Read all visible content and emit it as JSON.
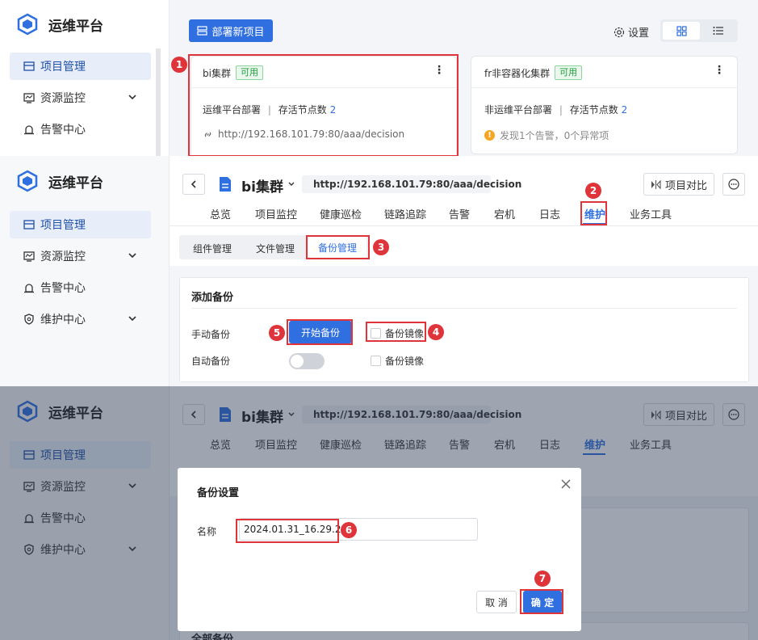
{
  "brand": {
    "name": "运维平台"
  },
  "nav": {
    "project": "项目管理",
    "resource": "资源监控",
    "alert": "告警中心",
    "maintain": "维护中心"
  },
  "panel1": {
    "deploy_button": "部署新项目",
    "settings_label": "设置",
    "card1": {
      "name": "bi集群",
      "status": "可用",
      "info_prefix": "运维平台部署",
      "separator": "|",
      "nodes_label": "存活节点数",
      "nodes_count": "2",
      "url": "http://192.168.101.79:80/aaa/decision"
    },
    "card2": {
      "name": "fr非容器化集群",
      "status": "可用",
      "info_prefix": "非运维平台部署",
      "separator": "|",
      "nodes_label": "存活节点数",
      "nodes_count": "2",
      "alert_text": "发现1个告警，0个异常项"
    }
  },
  "header": {
    "project_name": "bi集群",
    "url": "http://192.168.101.79:80/aaa/decision",
    "compare_button": "项目对比",
    "tabs": [
      "总览",
      "项目监控",
      "健康巡检",
      "链路追踪",
      "告警",
      "宕机",
      "日志",
      "维护",
      "业务工具"
    ]
  },
  "subtabs": [
    "组件管理",
    "文件管理",
    "备份管理"
  ],
  "backup": {
    "section_title": "添加备份",
    "manual_label": "手动备份",
    "start_button": "开始备份",
    "mirror_label": "备份镜像",
    "auto_label": "自动备份",
    "mirror_label2": "备份镜像"
  },
  "dialog": {
    "title": "备份设置",
    "name_label": "名称",
    "name_value": "2024.01.31_16.29.25",
    "cancel": "取 消",
    "confirm": "确 定"
  },
  "panel3_peek": {
    "all_backups": "全部备份"
  },
  "badges": [
    "1",
    "2",
    "3",
    "4",
    "5",
    "6",
    "7"
  ],
  "colors": {
    "accent": "#2f6fe0",
    "annotation": "#e0343b",
    "ok": "#1f9d3c",
    "warn": "#f5a623"
  }
}
